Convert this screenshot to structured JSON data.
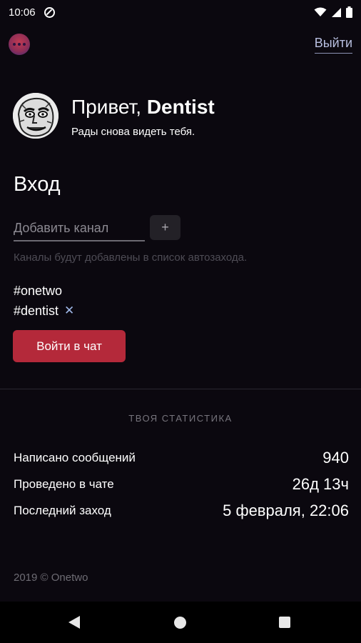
{
  "status_bar": {
    "time": "10:06",
    "icons": [
      "dnd-icon",
      "wifi-icon",
      "signal-icon",
      "battery-icon"
    ]
  },
  "header": {
    "logo_icon": "app-logo",
    "logout_label": "Выйти"
  },
  "greeting": {
    "hello": "Привет,",
    "username": "Dentist",
    "subtitle": "Рады снова видеть тебя."
  },
  "login": {
    "heading": "Вход",
    "channel_input_placeholder": "Добавить канал",
    "channel_input_value": "",
    "add_button_label": "+",
    "hint": "Каналы будут добавлены в список автозахода.",
    "channels": [
      {
        "name": "#onetwo",
        "removable": false
      },
      {
        "name": "#dentist",
        "removable": true,
        "remove_label": "✕"
      }
    ],
    "join_button_label": "Войти в чат"
  },
  "stats": {
    "title": "ТВОЯ СТАТИСТИКА",
    "rows": [
      {
        "label": "Написано сообщений",
        "value": "940"
      },
      {
        "label": "Проведено в чате",
        "value": "26д 13ч"
      },
      {
        "label": "Последний заход",
        "value": "5 февраля, 22:06"
      }
    ]
  },
  "footer": {
    "copyright": "2019 © Onetwo"
  },
  "colors": {
    "background": "#0b080f",
    "accent": "#b4293a",
    "link": "#b8bfe0",
    "muted": "#4e4c55"
  },
  "nav_bar": {
    "icons": [
      "back-icon",
      "home-icon",
      "recents-icon"
    ]
  }
}
